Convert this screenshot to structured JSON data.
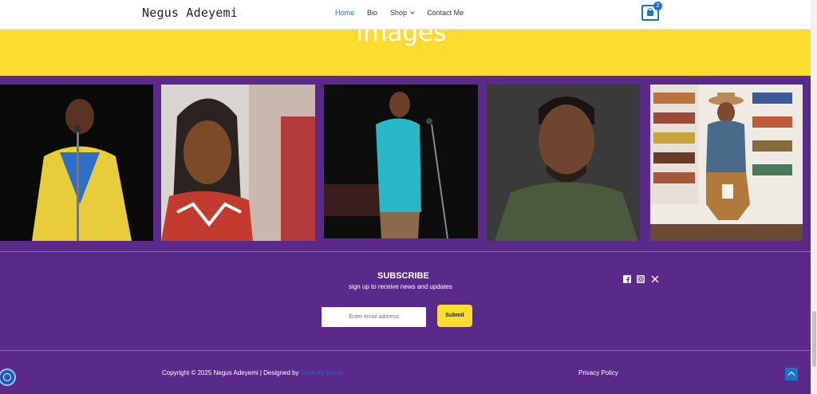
{
  "header": {
    "site_title": "Negus Adeyemi",
    "nav": [
      {
        "label": "Home",
        "active": true
      },
      {
        "label": "Bio"
      },
      {
        "label": "Shop",
        "has_dropdown": true
      },
      {
        "label": "Contact Me"
      }
    ],
    "cart_count": "2"
  },
  "hero": {
    "title": "Images"
  },
  "gallery": {
    "photos": [
      {
        "name": "performer-yellow-jacket"
      },
      {
        "name": "portrait-dreadlocks"
      },
      {
        "name": "performer-teal-shirt"
      },
      {
        "name": "portrait-green-sweater"
      },
      {
        "name": "seated-bookstore-hat"
      }
    ]
  },
  "subscribe": {
    "title": "SUBSCRIBE",
    "subtitle": "sign up to receive news and updates",
    "email_placeholder": "Enter email address",
    "submit_label": "Submit"
  },
  "social": [
    "facebook-icon",
    "instagram-icon",
    "x-icon"
  ],
  "footer": {
    "copyright": "Copyright © 2025 Negus Adeyemi | Designed by ",
    "designer": "Sankofa Visual",
    "privacy": "Privacy Policy"
  },
  "colors": {
    "purple": "#5a2a8a",
    "yellow": "#fddc2e",
    "accent": "#1e73be"
  }
}
